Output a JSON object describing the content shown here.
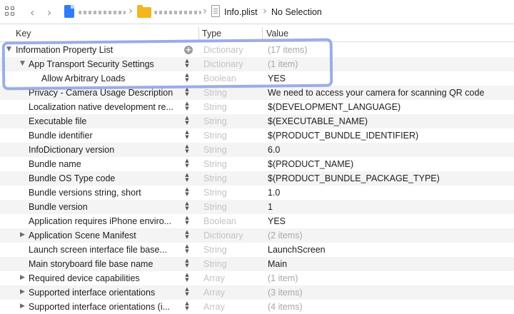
{
  "jumpbar": {
    "grid_icon": "grid-icon",
    "back_icon": "chevron-left-icon",
    "forward_icon": "chevron-right-icon",
    "file_name": "Info.plist",
    "selection": "No Selection"
  },
  "columns": {
    "key": "Key",
    "type": "Type",
    "value": "Value"
  },
  "rows": [
    {
      "key": "Information Property List",
      "type": "Dictionary",
      "value": "(17 items)"
    },
    {
      "key": "App Transport Security Settings",
      "type": "Dictionary",
      "value": "(1 item)"
    },
    {
      "key": "Allow Arbitrary Loads",
      "type": "Boolean",
      "value": "YES"
    },
    {
      "key": "Privacy - Camera Usage Description",
      "type": "String",
      "value": "We need to access your camera for scanning QR code"
    },
    {
      "key": "Localization native development re...",
      "type": "String",
      "value": "$(DEVELOPMENT_LANGUAGE)"
    },
    {
      "key": "Executable file",
      "type": "String",
      "value": "$(EXECUTABLE_NAME)"
    },
    {
      "key": "Bundle identifier",
      "type": "String",
      "value": "$(PRODUCT_BUNDLE_IDENTIFIER)"
    },
    {
      "key": "InfoDictionary version",
      "type": "String",
      "value": "6.0"
    },
    {
      "key": "Bundle name",
      "type": "String",
      "value": "$(PRODUCT_NAME)"
    },
    {
      "key": "Bundle OS Type code",
      "type": "String",
      "value": "$(PRODUCT_BUNDLE_PACKAGE_TYPE)"
    },
    {
      "key": "Bundle versions string, short",
      "type": "String",
      "value": "1.0"
    },
    {
      "key": "Bundle version",
      "type": "String",
      "value": "1"
    },
    {
      "key": "Application requires iPhone enviro...",
      "type": "Boolean",
      "value": "YES"
    },
    {
      "key": "Application Scene Manifest",
      "type": "Dictionary",
      "value": "(2 items)"
    },
    {
      "key": "Launch screen interface file base...",
      "type": "String",
      "value": "LaunchScreen"
    },
    {
      "key": "Main storyboard file base name",
      "type": "String",
      "value": "Main"
    },
    {
      "key": "Required device capabilities",
      "type": "Array",
      "value": "(1 item)"
    },
    {
      "key": "Supported interface orientations",
      "type": "Array",
      "value": "(3 items)"
    },
    {
      "key": "Supported interface orientations (i...",
      "type": "Array",
      "value": "(4 items)"
    }
  ],
  "colors": {
    "highlight": "#8ea5e8",
    "type_text": "#c3c3c3",
    "folder": "#f3b620",
    "project": "#2f7cf6"
  }
}
